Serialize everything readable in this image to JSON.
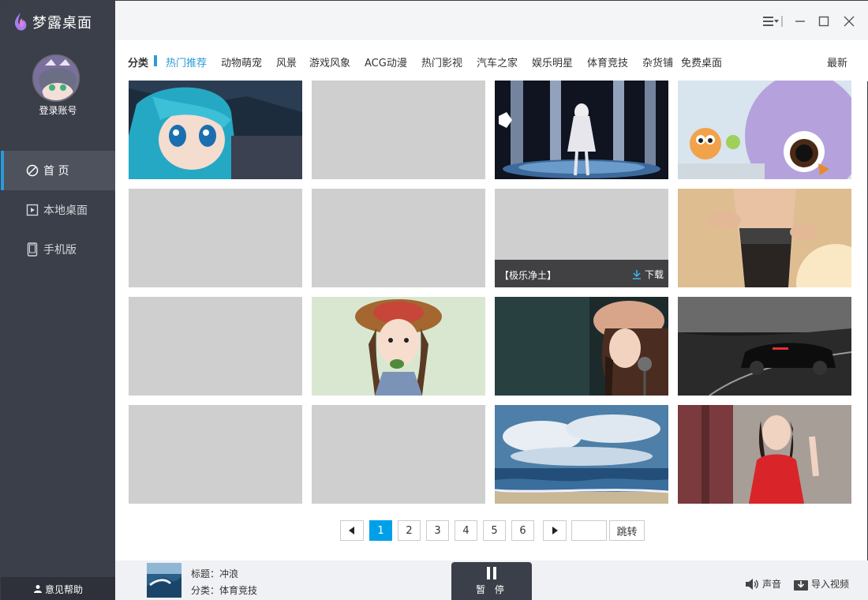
{
  "app": {
    "title": "梦露桌面",
    "login_label": "登录账号",
    "help_label": "意见帮助"
  },
  "nav": {
    "home": "首 页",
    "local": "本地桌面",
    "mobile": "手机版"
  },
  "categories": {
    "label": "分类",
    "items": [
      "热门推荐",
      "动物萌宠",
      "风景",
      "游戏风象",
      "ACG动漫",
      "热门影视",
      "汽车之家",
      "娱乐明星",
      "体育竞技",
      "杂货铺",
      "免费桌面"
    ],
    "sort": "最新"
  },
  "grid": {
    "hover_title": "【极乐净土】",
    "download_label": "下载"
  },
  "pager": {
    "pages": [
      "1",
      "2",
      "3",
      "4",
      "5",
      "6"
    ],
    "current": "1",
    "jump_label": "跳转",
    "jump_value": ""
  },
  "bottom": {
    "title_line": "标题：冲浪",
    "category_line": "分类：体育竞技",
    "pause_label": "暂 停",
    "sound_label": "声音",
    "import_label": "导入视频"
  },
  "colors": {
    "accent": "#2b9bd8",
    "page_active": "#00a0e9",
    "sidebar": "#3b3f49"
  }
}
